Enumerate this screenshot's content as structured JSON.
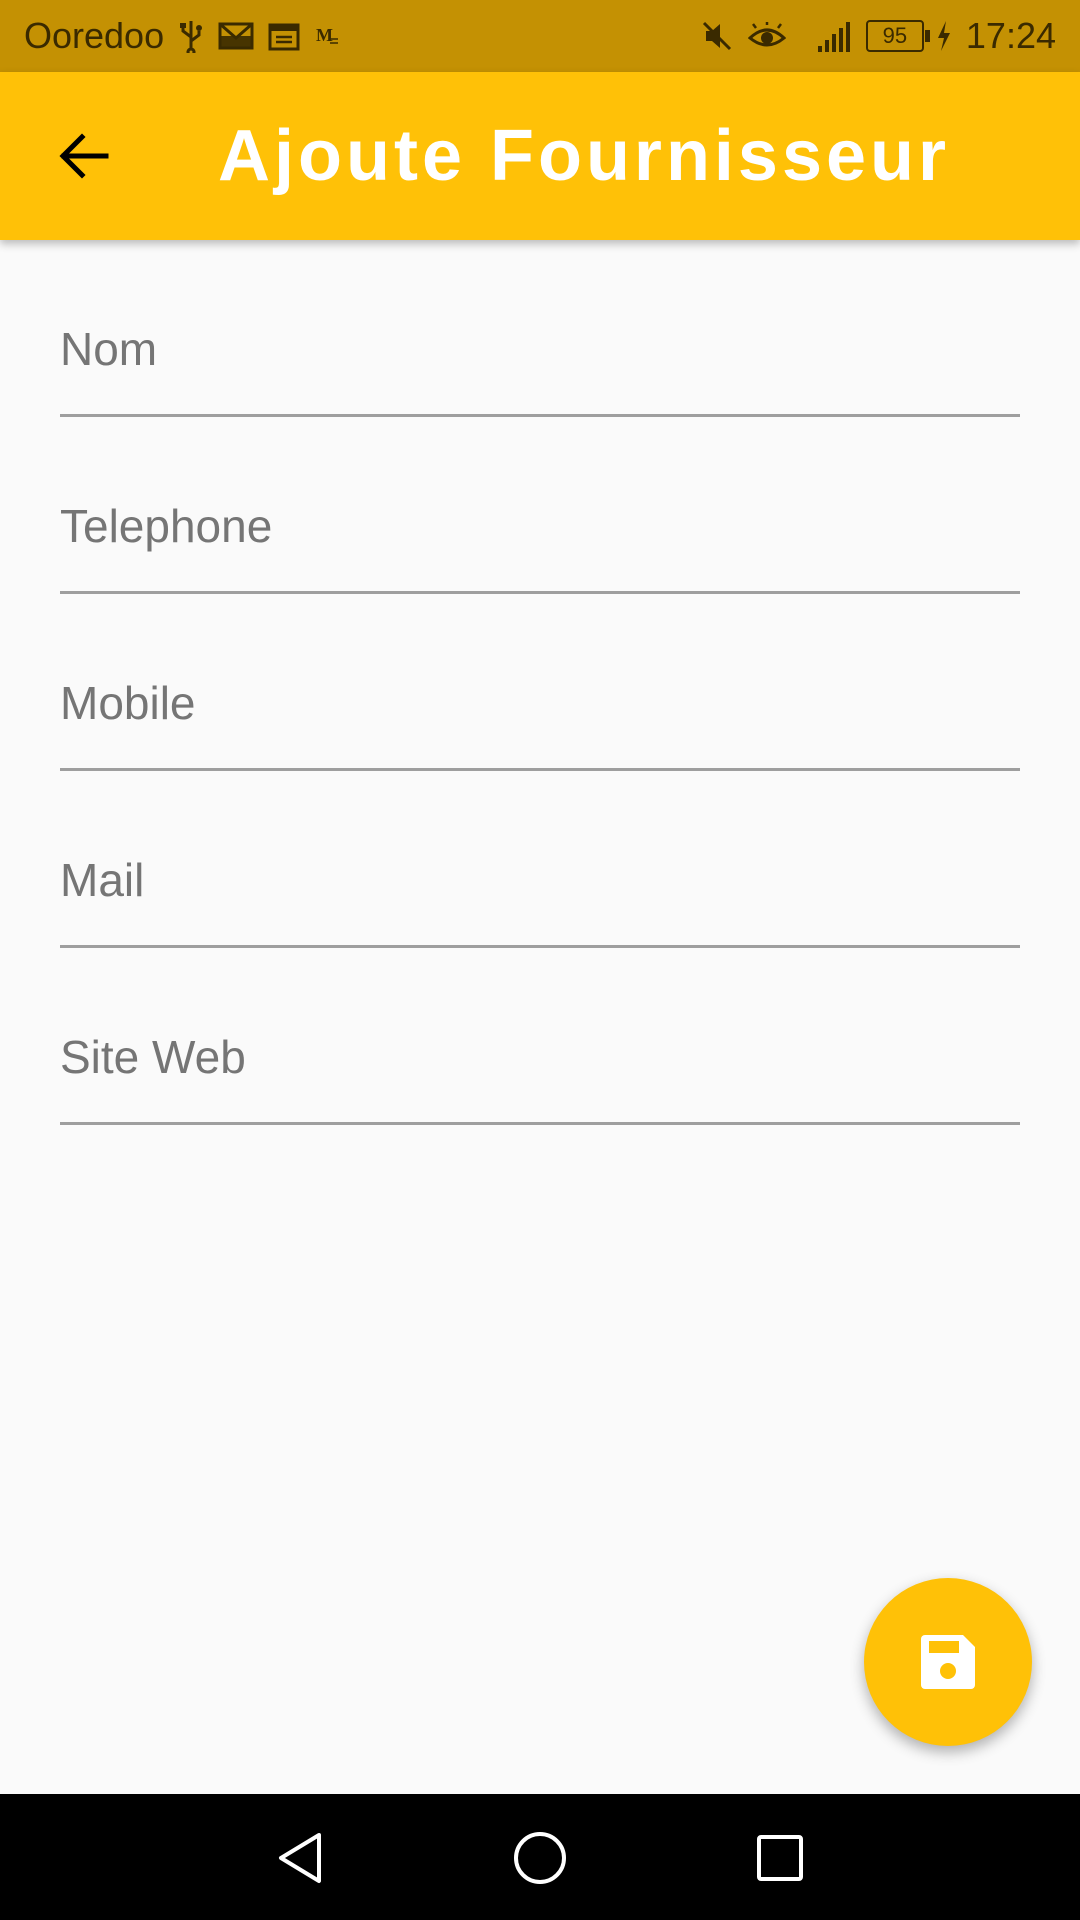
{
  "status_bar": {
    "carrier": "Ooredoo",
    "battery_level": "95",
    "time": "17:24",
    "icons_left": [
      "usb-icon",
      "gmail-icon",
      "calendar-icon",
      "mail-icon"
    ],
    "icons_right": [
      "mute-icon",
      "eye-icon",
      "signal-icon",
      "battery-icon",
      "charging-icon"
    ],
    "background_color": "#c49103"
  },
  "app_bar": {
    "title": "Ajoute Fournisseur",
    "back_icon": "arrow-back-icon",
    "color": "#ffc107"
  },
  "form": {
    "fields": [
      {
        "name": "nom",
        "placeholder": "Nom",
        "value": ""
      },
      {
        "name": "telephone",
        "placeholder": "Telephone",
        "value": ""
      },
      {
        "name": "mobile",
        "placeholder": "Mobile",
        "value": ""
      },
      {
        "name": "mail",
        "placeholder": "Mail",
        "value": ""
      },
      {
        "name": "site-web",
        "placeholder": "Site Web",
        "value": ""
      }
    ]
  },
  "fab": {
    "icon": "save-icon",
    "color": "#ffc107"
  },
  "nav_bar": {
    "icons": [
      "back-triangle-icon",
      "home-circle-icon",
      "recents-square-icon"
    ]
  }
}
